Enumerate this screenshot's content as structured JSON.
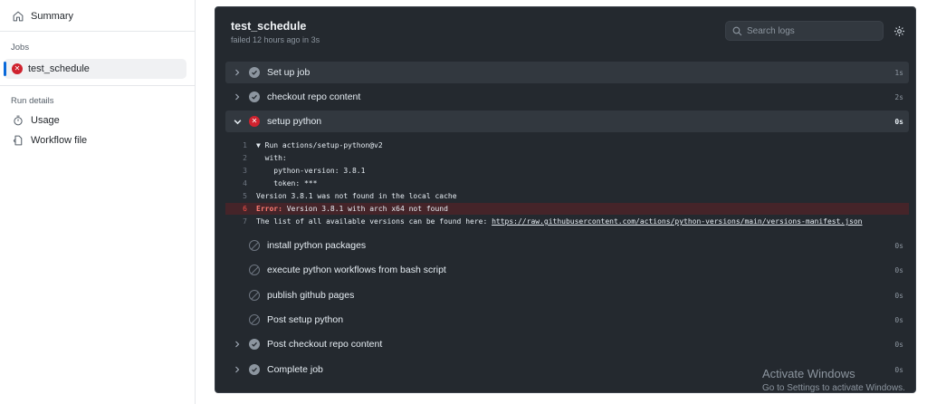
{
  "sidebar": {
    "summary": "Summary",
    "jobs_header": "Jobs",
    "job": "test_schedule",
    "run_details_header": "Run details",
    "usage": "Usage",
    "workflow_file": "Workflow file"
  },
  "panel": {
    "title": "test_schedule",
    "subtitle": "failed 12 hours ago in 3s",
    "search_placeholder": "Search logs"
  },
  "steps": [
    {
      "label": "Set up job",
      "duration": "1s"
    },
    {
      "label": "checkout repo content",
      "duration": "2s"
    },
    {
      "label": "setup python",
      "duration": "0s"
    },
    {
      "label": "install python packages",
      "duration": "0s"
    },
    {
      "label": "execute python workflows from bash script",
      "duration": "0s"
    },
    {
      "label": "publish github pages",
      "duration": "0s"
    },
    {
      "label": "Post setup python",
      "duration": "0s"
    },
    {
      "label": "Post checkout repo content",
      "duration": "0s"
    },
    {
      "label": "Complete job",
      "duration": "0s"
    }
  ],
  "log": [
    {
      "n": "1",
      "text": "▼ Run actions/setup-python@v2"
    },
    {
      "n": "2",
      "text": "  with:"
    },
    {
      "n": "3",
      "text": "    python-version: 3.8.1"
    },
    {
      "n": "4",
      "text": "    token: ***"
    },
    {
      "n": "5",
      "text": "Version 3.8.1 was not found in the local cache"
    },
    {
      "n": "6",
      "label": "Error:",
      "text": " Version 3.8.1 with arch x64 not found"
    },
    {
      "n": "7",
      "text": "The list of all available versions can be found here: ",
      "link": "https://raw.githubusercontent.com/actions/python-versions/main/versions-manifest.json"
    }
  ],
  "watermark": {
    "title": "Activate Windows",
    "sub": "Go to Settings to activate Windows."
  },
  "colors": {
    "panel_bg": "#24292f",
    "fail": "#cf222e",
    "accent": "#0969da"
  }
}
